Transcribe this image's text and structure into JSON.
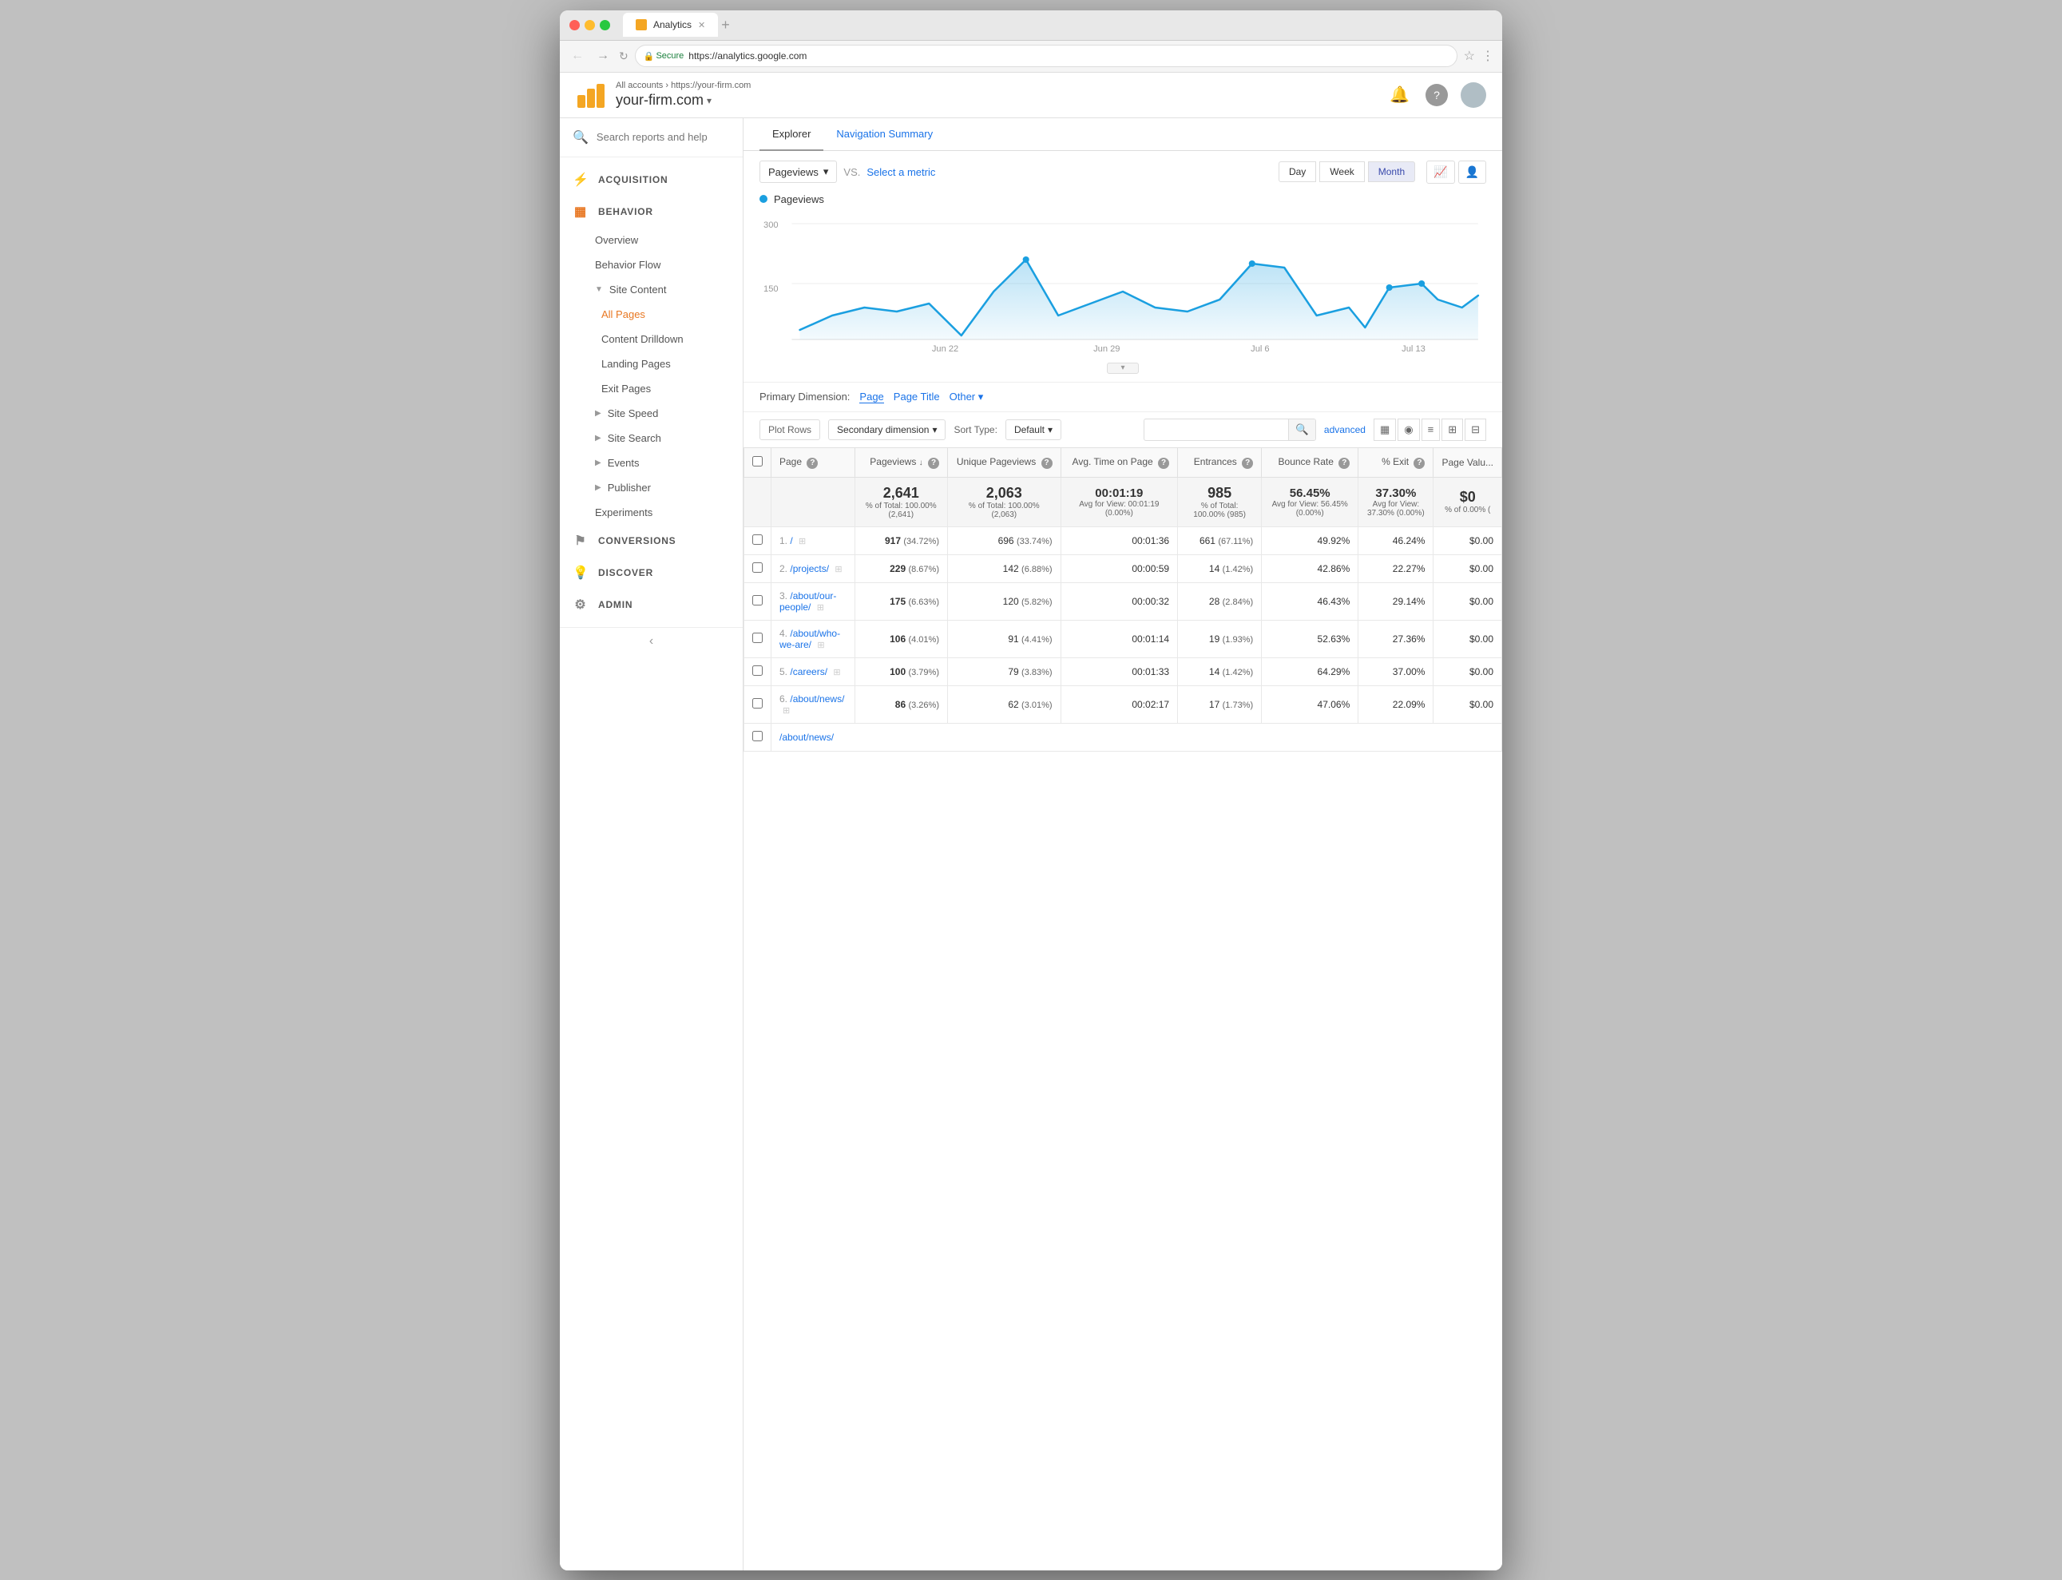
{
  "browser": {
    "tab_title": "Analytics",
    "url": "https://analytics.google.com",
    "secure_text": "Secure",
    "back_btn": "←",
    "forward_btn": "→"
  },
  "header": {
    "breadcrumb_all": "All accounts",
    "breadcrumb_sep": "›",
    "breadcrumb_account": "https://your-firm.com",
    "account_name": "your-firm.com",
    "dropdown_arrow": "▾",
    "bell_icon": "🔔",
    "help_icon": "?",
    "app_name": "Analytics"
  },
  "sidebar": {
    "search_placeholder": "Search reports and help",
    "nav": [
      {
        "id": "acquisition",
        "label": "ACQUISITION",
        "icon": "⚡"
      },
      {
        "id": "behavior",
        "label": "BEHAVIOR",
        "icon": "▦"
      },
      {
        "id": "overview",
        "label": "Overview",
        "sub": true
      },
      {
        "id": "behavior-flow",
        "label": "Behavior Flow",
        "sub": true
      },
      {
        "id": "site-content",
        "label": "Site Content",
        "sub": true,
        "expand": true
      },
      {
        "id": "all-pages",
        "label": "All Pages",
        "sub": true,
        "indent": true,
        "active": true
      },
      {
        "id": "content-drilldown",
        "label": "Content Drilldown",
        "sub": true,
        "indent": true
      },
      {
        "id": "landing-pages",
        "label": "Landing Pages",
        "sub": true,
        "indent": true
      },
      {
        "id": "exit-pages",
        "label": "Exit Pages",
        "sub": true,
        "indent": true
      },
      {
        "id": "site-speed",
        "label": "Site Speed",
        "sub": true,
        "expandable": true
      },
      {
        "id": "site-search",
        "label": "Site Search",
        "sub": true,
        "expandable": true
      },
      {
        "id": "events",
        "label": "Events",
        "sub": true,
        "expandable": true
      },
      {
        "id": "publisher",
        "label": "Publisher",
        "sub": true,
        "expandable": true
      },
      {
        "id": "experiments",
        "label": "Experiments",
        "sub": true
      },
      {
        "id": "conversions",
        "label": "CONVERSIONS",
        "icon": "⚑"
      },
      {
        "id": "discover",
        "label": "DISCOVER",
        "icon": "💡"
      },
      {
        "id": "admin",
        "label": "ADMIN",
        "icon": "⚙"
      }
    ],
    "collapse_btn": "‹"
  },
  "report": {
    "tabs": [
      {
        "id": "explorer",
        "label": "Explorer",
        "active": true
      },
      {
        "id": "nav-summary",
        "label": "Navigation Summary",
        "active": false
      }
    ],
    "chart": {
      "metric_label": "Pageviews",
      "vs_label": "VS.",
      "select_metric": "Select a metric",
      "time_btns": [
        "Day",
        "Week",
        "Month"
      ],
      "active_time": "Month",
      "y_labels": [
        "300",
        "150"
      ],
      "x_labels": [
        "Jun 22",
        "Jun 29",
        "Jul 6",
        "Jul 13"
      ],
      "legend_label": "Pageviews"
    },
    "dimensions": {
      "label": "Primary Dimension:",
      "options": [
        "Page",
        "Page Title",
        "Other ▾"
      ],
      "active": "Page"
    },
    "table_controls": {
      "plot_rows": "Plot Rows",
      "secondary_dim": "Secondary dimension",
      "sort_type_label": "Sort Type:",
      "sort_default": "Default",
      "advanced": "advanced"
    },
    "table": {
      "headers": [
        {
          "id": "page",
          "label": "Page",
          "help": true
        },
        {
          "id": "pageviews",
          "label": "Pageviews",
          "help": true,
          "sort": true
        },
        {
          "id": "unique-pageviews",
          "label": "Unique Pageviews",
          "help": true
        },
        {
          "id": "avg-time",
          "label": "Avg. Time on Page",
          "help": true
        },
        {
          "id": "entrances",
          "label": "Entrances",
          "help": true
        },
        {
          "id": "bounce-rate",
          "label": "Bounce Rate",
          "help": true
        },
        {
          "id": "pct-exit",
          "label": "% Exit",
          "help": true
        },
        {
          "id": "page-value",
          "label": "Page Valu...",
          "help": false
        }
      ],
      "summary": {
        "pageviews": "2,641",
        "pageviews_sub": "% of Total: 100.00% (2,641)",
        "unique_pv": "2,063",
        "unique_pv_sub": "% of Total: 100.00% (2,063)",
        "avg_time": "00:01:19",
        "avg_time_sub": "Avg for View: 00:01:19 (0.00%)",
        "entrances": "985",
        "entrances_sub": "% of Total: 100.00% (985)",
        "bounce_rate": "56.45%",
        "bounce_rate_sub": "Avg for View: 56.45% (0.00%)",
        "pct_exit": "37.30%",
        "pct_exit_sub": "Avg for View: 37.30% (0.00%)",
        "page_value": "$0",
        "page_value_sub": "% of 0.00% ("
      },
      "rows": [
        {
          "num": "1.",
          "page": "/",
          "pageviews": "917",
          "pv_pct": "(34.72%)",
          "unique_pv": "696",
          "upv_pct": "(33.74%)",
          "avg_time": "00:01:36",
          "entrances": "661",
          "ent_pct": "(67.11%)",
          "bounce_rate": "49.92%",
          "pct_exit": "46.24%",
          "page_value": "$0.00"
        },
        {
          "num": "2.",
          "page": "/projects/",
          "pageviews": "229",
          "pv_pct": "(8.67%)",
          "unique_pv": "142",
          "upv_pct": "(6.88%)",
          "avg_time": "00:00:59",
          "entrances": "14",
          "ent_pct": "(1.42%)",
          "bounce_rate": "42.86%",
          "pct_exit": "22.27%",
          "page_value": "$0.00"
        },
        {
          "num": "3.",
          "page": "/about/our-people/",
          "pageviews": "175",
          "pv_pct": "(6.63%)",
          "unique_pv": "120",
          "upv_pct": "(5.82%)",
          "avg_time": "00:00:32",
          "entrances": "28",
          "ent_pct": "(2.84%)",
          "bounce_rate": "46.43%",
          "pct_exit": "29.14%",
          "page_value": "$0.00"
        },
        {
          "num": "4.",
          "page": "/about/who-we-are/",
          "pageviews": "106",
          "pv_pct": "(4.01%)",
          "unique_pv": "91",
          "upv_pct": "(4.41%)",
          "avg_time": "00:01:14",
          "entrances": "19",
          "ent_pct": "(1.93%)",
          "bounce_rate": "52.63%",
          "pct_exit": "27.36%",
          "page_value": "$0.00"
        },
        {
          "num": "5.",
          "page": "/careers/",
          "pageviews": "100",
          "pv_pct": "(3.79%)",
          "unique_pv": "79",
          "upv_pct": "(3.83%)",
          "avg_time": "00:01:33",
          "entrances": "14",
          "ent_pct": "(1.42%)",
          "bounce_rate": "64.29%",
          "pct_exit": "37.00%",
          "page_value": "$0.00"
        },
        {
          "num": "6.",
          "page": "/about/news/",
          "pageviews": "86",
          "pv_pct": "(3.26%)",
          "unique_pv": "62",
          "upv_pct": "(3.01%)",
          "avg_time": "00:02:17",
          "entrances": "17",
          "ent_pct": "(1.73%)",
          "bounce_rate": "47.06%",
          "pct_exit": "22.09%",
          "page_value": "$0.00"
        }
      ]
    }
  }
}
